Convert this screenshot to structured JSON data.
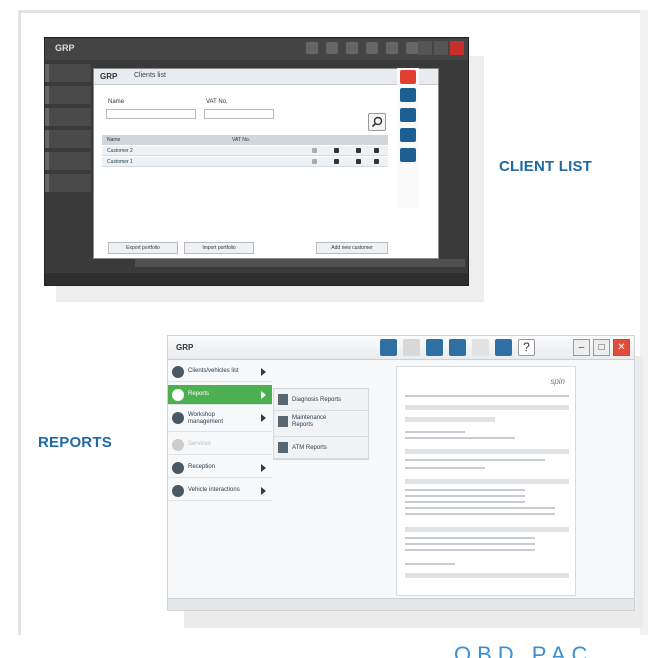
{
  "captions": {
    "client_list": "CLIENT LIST",
    "reports": "REPORTS",
    "cut_off_heading": "OBD PAC"
  },
  "screenshot_client": {
    "app_logo": "GRP",
    "dialog": {
      "logo": "GRP",
      "title": "Clients list",
      "field_name_label": "Name",
      "field_vat_label": "VAT No.",
      "columns": [
        "Name",
        "VAT No."
      ],
      "rows": [
        {
          "name": "Customer 2"
        },
        {
          "name": "Customer 1"
        }
      ],
      "buttons": {
        "export": "Export portfolio",
        "import": "Import portfolio",
        "add": "Add new customer"
      }
    }
  },
  "screenshot_reports": {
    "app_logo": "GRP",
    "menu": [
      {
        "label": "Clients/vehicles list",
        "state": "normal"
      },
      {
        "label": "Reports",
        "state": "active"
      },
      {
        "label": "Workshop management",
        "state": "normal"
      },
      {
        "label": "Services",
        "state": "disabled"
      },
      {
        "label": "Reception",
        "state": "normal"
      },
      {
        "label": "Vehicle interactions",
        "state": "normal"
      }
    ],
    "submenu": [
      {
        "label": "Diagnosis Reports"
      },
      {
        "label": "Maintenance Reports"
      },
      {
        "label": "ATM Reports"
      }
    ],
    "report_logo": "spin",
    "colors": {
      "active_menu": "#4caf50",
      "close_button": "#e24c3a",
      "caption": "#1f6aa5"
    }
  }
}
